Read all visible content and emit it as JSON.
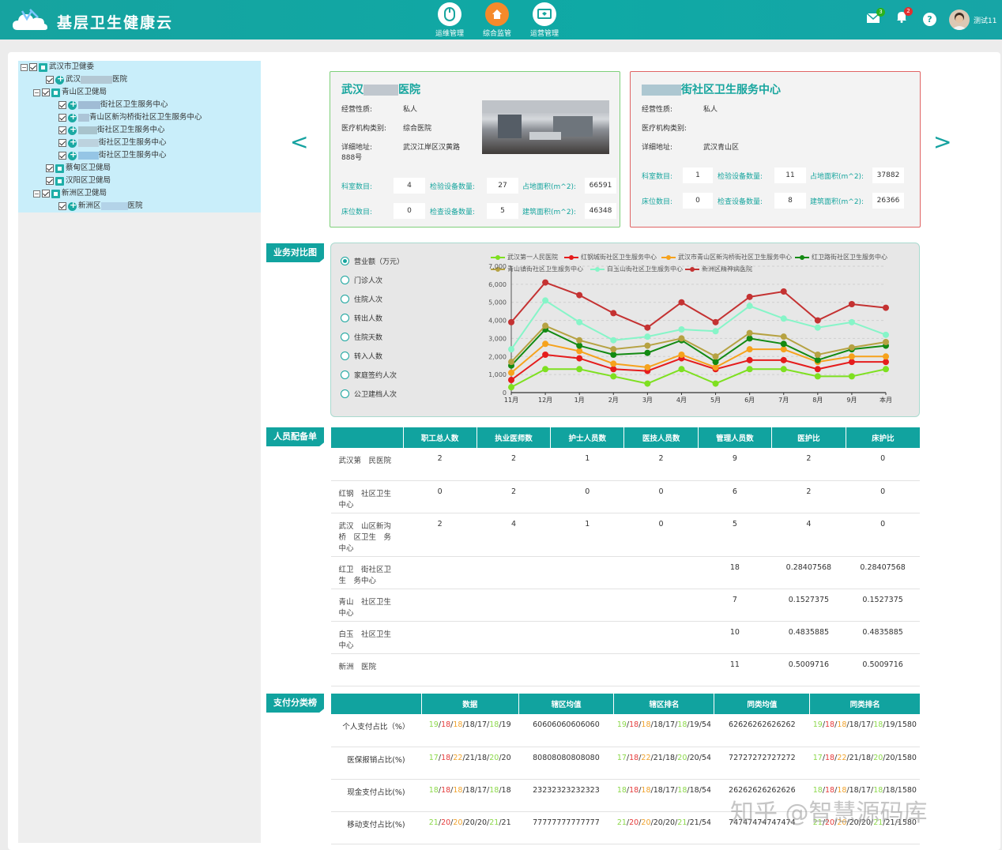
{
  "header": {
    "title": "基层卫生健康云",
    "nav": [
      {
        "label": "运维管理",
        "icon": "mouse-icon",
        "color": "#ffffff"
      },
      {
        "label": "综合监管",
        "icon": "home-icon",
        "color": "#f58a2b"
      },
      {
        "label": "运营管理",
        "icon": "chart-board-icon",
        "color": "#ffffff"
      }
    ],
    "mail_badge": "3",
    "bell_badge": "2",
    "help": "?",
    "username": "测试11"
  },
  "tree": {
    "root": "武汉市卫健委",
    "n1": "武汉",
    "n1b": "医院",
    "n2": "青山区卫健局",
    "n3": "街社区卫生服务中心",
    "n4": "青山区新沟桥街社区卫生服务中心",
    "n5": "街社区卫生服务中心",
    "n6": "街社区卫生服务中心",
    "n7": "街社区卫生服务中心",
    "n8": "蔡甸区卫健局",
    "n9": "汉阳区卫健局",
    "n10": "新洲区卫健局",
    "n11": "新洲区",
    "n11b": "医院"
  },
  "cards": [
    {
      "title_a": "武汉",
      "title_b": "医院",
      "type_label": "经营性质:",
      "type": "私人",
      "cat_label": "医疗机构类别:",
      "cat": "综合医院",
      "addr_label": "详细地址:",
      "addr": "武汉江岸区汉黄路",
      "addr2": "888号",
      "dept_label": "科室数目:",
      "dept": "4",
      "lab_label": "检验设备数量:",
      "lab": "27",
      "area_label": "占地面积(m^2):",
      "area": "66591",
      "bed_label": "床位数目:",
      "bed": "0",
      "chk_label": "检查设备数量:",
      "chk": "5",
      "build_label": "建筑面积(m^2):",
      "build": "46348"
    },
    {
      "title": "街社区卫生服务中心",
      "type_label": "经营性质:",
      "type": "私人",
      "cat_label": "医疗机构类别:",
      "cat": "",
      "addr_label": "详细地址:",
      "addr": "武汉青山区",
      "dept_label": "科室数目:",
      "dept": "1",
      "lab_label": "检验设备数量:",
      "lab": "11",
      "area_label": "占地面积(m^2):",
      "area": "37882",
      "bed_label": "床位数目:",
      "bed": "0",
      "chk_label": "检查设备数量:",
      "chk": "8",
      "build_label": "建筑面积(m^2):",
      "build": "26366"
    }
  ],
  "nav_arrows": {
    "prev": "<",
    "next": ">"
  },
  "sections": {
    "compare": "业务对比图",
    "staff": "人员配备单",
    "pay": "支付分类榜"
  },
  "metrics": [
    "营业额（万元）",
    "门诊人次",
    "住院人次",
    "转出人数",
    "住院天数",
    "转入人数",
    "家庭签约人次",
    "公卫建档人次"
  ],
  "chart_data": {
    "type": "line",
    "x": [
      "11月",
      "12月",
      "1月",
      "2月",
      "3月",
      "4月",
      "5月",
      "6月",
      "7月",
      "8月",
      "9月",
      "本月"
    ],
    "ylim": [
      0,
      7000
    ],
    "yticks": [
      "0",
      "1,000",
      "2,000",
      "3,000",
      "4,000",
      "5,000",
      "6,000",
      "7,000"
    ],
    "grid": true,
    "legend_position": "top",
    "series": [
      {
        "name": "武汉第一人民医院",
        "color": "#7ee020",
        "values": [
          300,
          1300,
          1300,
          900,
          500,
          1300,
          500,
          1300,
          1300,
          900,
          900,
          1300
        ]
      },
      {
        "name": "红钢城街社区卫生服务中心",
        "color": "#e51c1c",
        "values": [
          700,
          2100,
          1900,
          1300,
          1200,
          1900,
          1300,
          1800,
          1800,
          1300,
          1700,
          1700
        ]
      },
      {
        "name": "武汉市青山区新沟桥街社区卫生服务中心",
        "color": "#f6a21c",
        "values": [
          1100,
          2700,
          2300,
          1600,
          1400,
          2100,
          1400,
          2400,
          2400,
          1700,
          2000,
          2000
        ]
      },
      {
        "name": "红卫路街社区卫生服务中心",
        "color": "#138a12",
        "values": [
          1500,
          3500,
          2600,
          2100,
          2200,
          2900,
          1700,
          3000,
          2700,
          1800,
          2400,
          2600
        ]
      },
      {
        "name": "青山镇街社区卫生服务中心",
        "color": "#b6a242",
        "values": [
          1700,
          3700,
          2900,
          2400,
          2600,
          3000,
          2000,
          3300,
          3100,
          2100,
          2500,
          2800
        ]
      },
      {
        "name": "白玉山街社区卫生服务中心",
        "color": "#86f5c8",
        "values": [
          2400,
          5100,
          3900,
          2900,
          3100,
          3500,
          3400,
          4800,
          4100,
          3600,
          3900,
          3200
        ]
      },
      {
        "name": "新洲区精神病医院",
        "color": "#c43232",
        "values": [
          3900,
          6100,
          5400,
          4400,
          3600,
          5000,
          3900,
          5300,
          5600,
          4000,
          4900,
          4700
        ]
      }
    ]
  },
  "staff": {
    "headers": [
      "",
      "职工总人数",
      "执业医师数",
      "护士人员数",
      "医技人员数",
      "管理人员数",
      "医护比",
      "床护比"
    ],
    "rows": [
      [
        "武汉第　民医院",
        "2",
        "2",
        "1",
        "2",
        "9",
        "2",
        "0"
      ],
      [
        "红钢　社区卫生　中心",
        "0",
        "2",
        "0",
        "0",
        "6",
        "2",
        "0"
      ],
      [
        "武汉　山区新沟桥　区卫生　务中心",
        "2",
        "4",
        "1",
        "0",
        "5",
        "4",
        "0"
      ],
      [
        "红卫　街社区卫生　务中心",
        "",
        "",
        "",
        "",
        "18",
        "0.28407568",
        "0.28407568"
      ],
      [
        "青山　社区卫生　中心",
        "",
        "",
        "",
        "",
        "7",
        "0.1527375",
        "0.1527375"
      ],
      [
        "白玉　社区卫生　中心",
        "",
        "",
        "",
        "",
        "10",
        "0.4835885",
        "0.4835885"
      ],
      [
        "新洲　医院",
        "",
        "",
        "",
        "",
        "11",
        "0.5009716",
        "0.5009716"
      ]
    ]
  },
  "pay": {
    "headers": [
      "",
      "数据",
      "辖区均值",
      "辖区排名",
      "同类均值",
      "同类排名"
    ],
    "rows": [
      {
        "label": "个人支付占比（%）",
        "data": "19/18/18/18/17/18/19",
        "avg": "60606060606060",
        "rank": "19/18/18/18/17/18/19/54",
        "cavg": "62626262626262",
        "crank": "19/18/18/18/17/18/19/1580"
      },
      {
        "label": "医保报销占比(%)",
        "data": "17/18/22/21/18/20/20",
        "avg": "80808080808080",
        "rank": "17/18/22/21/18/20/20/54",
        "cavg": "72727272727272",
        "crank": "17/18/22/21/18/20/20/1580"
      },
      {
        "label": "现金支付占比(%)",
        "data": "18/18/18/18/17/18/18",
        "avg": "23232323232323",
        "rank": "18/18/18/18/17/18/18/54",
        "cavg": "26262626262626",
        "crank": "18/18/18/18/17/18/18/1580"
      },
      {
        "label": "移动支付占比(%)",
        "data": "21/20/20/20/20/21/21",
        "avg": "77777777777777",
        "rank": "21/20/20/20/20/21/21/54",
        "cavg": "74747474747474",
        "crank": "21/20/20/20/20/21/21/1580"
      }
    ]
  },
  "watermark": "知乎 @智慧源码库"
}
